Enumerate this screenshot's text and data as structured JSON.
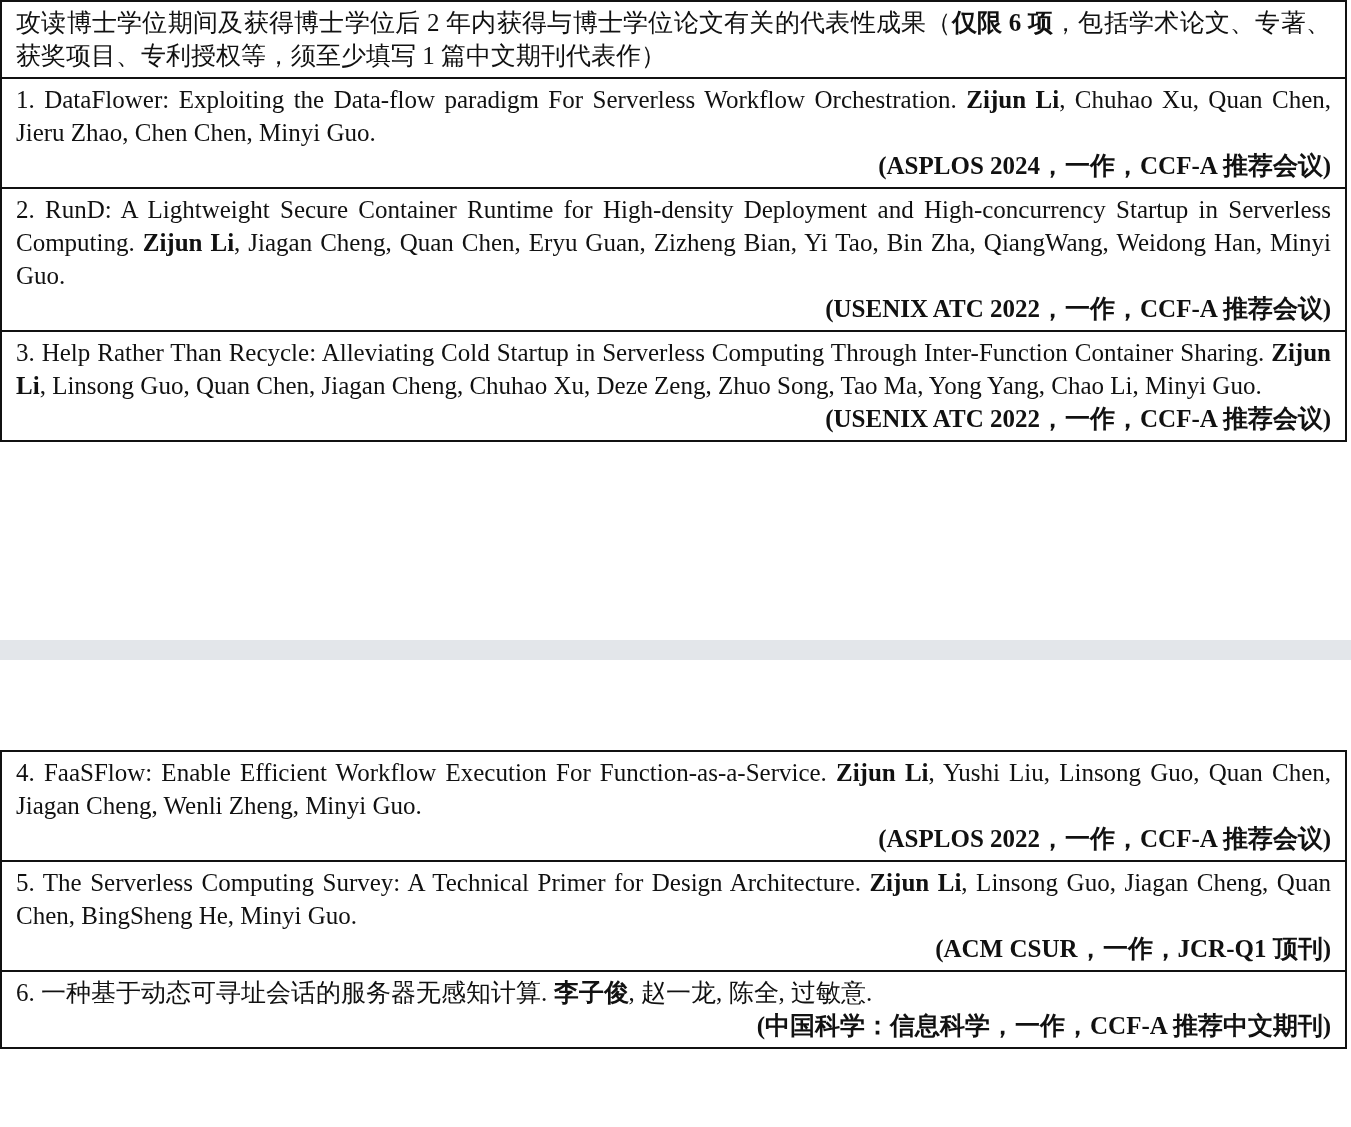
{
  "pages": [
    {
      "header": "攻读博士学位期间及获得博士学位后 2 年内获得与博士学位论文有关的代表性成果（**仅限 6 项**，包括学术论文、专著、获奖项目、专利授权等，须至少填写 1 篇中文期刊代表作）",
      "entries": [
        {
          "text": "1. DataFlower: Exploiting the Data-flow paradigm For Serverless Workflow Orchestration. **Zijun Li**, Chuhao Xu, Quan Chen, Jieru Zhao, Chen Chen, Minyi Guo.",
          "venue": "(ASPLOS 2024，一作，CCF-A 推荐会议)"
        },
        {
          "text": "2. RunD: A Lightweight Secure Container Runtime for High-density Deployment and High-concurrency Startup in Serverless Computing. **Zijun Li**, Jiagan Cheng, Quan Chen, Eryu Guan, Zizheng Bian, Yi Tao, Bin Zha, QiangWang, Weidong Han, Minyi Guo.",
          "venue": "(USENIX ATC 2022，一作，CCF-A 推荐会议)"
        },
        {
          "text": "3. Help Rather Than Recycle: Alleviating Cold Startup in Serverless Computing Through Inter-Function Container Sharing. **Zijun Li**, Linsong Guo, Quan Chen, Jiagan Cheng, Chuhao Xu, Deze Zeng, Zhuo Song, Tao Ma, Yong Yang, Chao Li, Minyi Guo.",
          "venue": "(USENIX ATC 2022，一作，CCF-A 推荐会议)"
        }
      ]
    },
    {
      "entries": [
        {
          "text": "4. FaaSFlow: Enable Efficient Workflow Execution For Function-as-a-Service. **Zijun Li**, Yushi Liu, Linsong Guo, Quan Chen, Jiagan Cheng, Wenli Zheng, Minyi Guo.",
          "venue": "(ASPLOS 2022，一作，CCF-A 推荐会议)"
        },
        {
          "text": "5. The Serverless Computing Survey: A Technical Primer for Design Architecture. **Zijun Li**, Linsong Guo, Jiagan Cheng, Quan Chen, BingSheng He, Minyi Guo.",
          "venue": "(ACM CSUR，一作，JCR-Q1 顶刊)"
        },
        {
          "text": "6. 一种基于动态可寻址会话的服务器无感知计算. **李子俊**, 赵一龙, 陈全, 过敏意.",
          "venue": "(中国科学：信息科学，一作，CCF-A 推荐中文期刊)"
        }
      ]
    }
  ]
}
